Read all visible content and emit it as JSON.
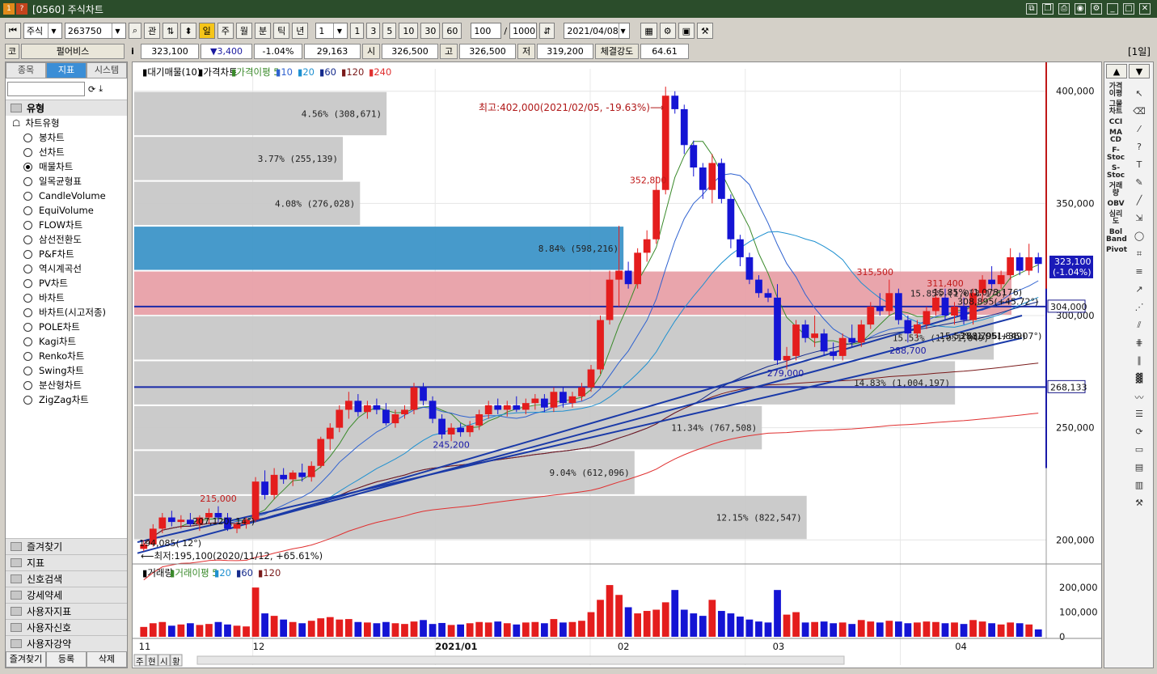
{
  "window": {
    "title": "[0560] 주식차트",
    "icons": [
      "1",
      "?"
    ]
  },
  "toolbar": {
    "market": "주식",
    "code": "263750",
    "btn_gwan": "관",
    "periods": [
      "일",
      "주",
      "월",
      "분",
      "틱",
      "년"
    ],
    "active_period": "일",
    "interval": "1",
    "quick_intervals": [
      "1",
      "3",
      "5",
      "10",
      "30",
      "60"
    ],
    "count": "100",
    "count_sep": "/",
    "max_count": "1000",
    "date": "2021/04/08"
  },
  "quote": {
    "code_label": "코",
    "name": "펄어비스",
    "info_label": "i",
    "price": "323,100",
    "change": "▼3,400",
    "change_pct": "-1.04%",
    "volume": "29,163",
    "open_label": "시",
    "open": "326,500",
    "high_label": "고",
    "high": "326,500",
    "low_label": "저",
    "low": "319,200",
    "strength_label": "체결강도",
    "strength": "64.61",
    "period_badge": "[1일]"
  },
  "left_panel": {
    "tabs": [
      "종목",
      "지표",
      "시스템"
    ],
    "active_tab": "지표",
    "section_type": "유형",
    "section_chart_type": "차트유형",
    "chart_types": [
      "봉차트",
      "선차트",
      "매물차트",
      "일목균형표",
      "CandleVolume",
      "EquiVolume",
      "FLOW차트",
      "삼선전환도",
      "P&F차트",
      "역시계곡선",
      "PV차트",
      "바차트",
      "바차트(시고저종)",
      "POLE차트",
      "Kagi차트",
      "Renko차트",
      "Swing차트",
      "분산형차트",
      "ZigZag차트"
    ],
    "selected_chart_type": "매물차트",
    "folders": [
      "즐겨찾기",
      "지표",
      "신호검색",
      "강세약세",
      "사용자지표",
      "사용자신호",
      "사용자강약"
    ],
    "bottom_tabs": [
      "즐겨찾기",
      "등록",
      "삭제"
    ]
  },
  "chart": {
    "legend_items": [
      {
        "text": "▮대기매물(10)",
        "color": "#000000"
      },
      {
        "text": "▮가격차트",
        "color": "#000000"
      },
      {
        "text": "▮가격이평 5",
        "color": "#3a8a2a"
      },
      {
        "text": "▮10",
        "color": "#2f62d0"
      },
      {
        "text": "▮20",
        "color": "#1e90d0"
      },
      {
        "text": "▮60",
        "color": "#142a8c"
      },
      {
        "text": "▮120",
        "color": "#7a1a1a"
      },
      {
        "text": "▮240",
        "color": "#e03030"
      }
    ],
    "annotations": {
      "high_note": "최고:402,000(2021/02/05, -19.63%)⟶",
      "low_note": "⟵최저:195,100(2020/11/12, +65.61%)",
      "peak_352": "352,800",
      "peak_215": "215,000",
      "low_245": "245,200",
      "low_279": "279,000",
      "peak_315": "315,500",
      "peak_311": "311,400",
      "low_288": "288,700",
      "trend_start": "194,085( 12°)",
      "trend_207": "207,120( 14°)",
      "overlap1": "15.85% (1,073,176)",
      "overlap2": "308,895(+45.72°)",
      "overlap3": "15.53%(1,051,849)",
      "overlap4": "288,796(+36.07°)"
    },
    "price_axis": [
      "400,000",
      "350,000",
      "300,000",
      "250,000",
      "200,000"
    ],
    "price_badge": "323,100",
    "price_badge_pct": "(-1.04%)",
    "line_badge_1": "304,000",
    "line_badge_2": "268,133",
    "volume_legend": [
      {
        "text": "▮거래량",
        "color": "#000000"
      },
      {
        "text": "▮거래이평 5",
        "color": "#3a8a2a"
      },
      {
        "text": "▮20",
        "color": "#1e90d0"
      },
      {
        "text": "▮60",
        "color": "#142a8c"
      },
      {
        "text": "▮120",
        "color": "#7a1a1a"
      }
    ],
    "volume_axis": [
      "200,000",
      "100,000",
      "0"
    ],
    "date_axis": [
      "11",
      "12",
      "2021/01",
      "02",
      "03",
      "04"
    ],
    "bottom_tabs": [
      "주",
      "현",
      "시",
      "황"
    ]
  },
  "colors": {
    "up": "#e41d1d",
    "down": "#1414d4",
    "profile_gray": "#c8c8c8",
    "profile_blue": "#3d95c8",
    "profile_pink": "#e8a0a8"
  },
  "chart_data": {
    "type": "bar",
    "title": "",
    "price_range": [
      190000,
      410000
    ],
    "profile_bins": [
      {
        "label": "4.56% (308,671)",
        "pct": 4.56,
        "volume": 308671,
        "lo": 380000,
        "hi": 400000
      },
      {
        "label": "3.77% (255,139)",
        "pct": 3.77,
        "volume": 255139,
        "lo": 360000,
        "hi": 380000
      },
      {
        "label": "4.08% (276,028)",
        "pct": 4.08,
        "volume": 276028,
        "lo": 340000,
        "hi": 360000
      },
      {
        "label": "8.84% (598,216)",
        "pct": 8.84,
        "volume": 598216,
        "lo": 320000,
        "hi": 340000,
        "highlight": "current"
      },
      {
        "label": "15.85% (1,073,176)",
        "pct": 15.85,
        "volume": 1073176,
        "lo": 300000,
        "hi": 320000,
        "highlight": "max"
      },
      {
        "label": "15.53% (1,051,849)",
        "pct": 15.53,
        "volume": 1051849,
        "lo": 280000,
        "hi": 300000
      },
      {
        "label": "14.83% (1,004,197)",
        "pct": 14.83,
        "volume": 1004197,
        "lo": 260000,
        "hi": 280000
      },
      {
        "label": "11.34% (767,508)",
        "pct": 11.34,
        "volume": 767508,
        "lo": 240000,
        "hi": 260000
      },
      {
        "label": "9.04% (612,096)",
        "pct": 9.04,
        "volume": 612096,
        "lo": 220000,
        "hi": 240000
      },
      {
        "label": "12.15% (822,547)",
        "pct": 12.15,
        "volume": 822547,
        "lo": 200000,
        "hi": 220000
      }
    ],
    "hlines": [
      304000,
      268133
    ],
    "candles": [
      [
        196,
        200,
        195,
        198
      ],
      [
        198,
        207,
        197,
        205
      ],
      [
        205,
        212,
        203,
        210
      ],
      [
        210,
        213,
        206,
        208
      ],
      [
        208,
        211,
        205,
        209
      ],
      [
        209,
        212,
        206,
        207
      ],
      [
        207,
        211,
        204,
        210
      ],
      [
        210,
        214,
        207,
        212
      ],
      [
        212,
        215,
        208,
        210
      ],
      [
        210,
        212,
        204,
        205
      ],
      [
        205,
        208,
        203,
        207
      ],
      [
        207,
        210,
        205,
        209
      ],
      [
        209,
        228,
        208,
        226
      ],
      [
        226,
        231,
        218,
        220
      ],
      [
        220,
        232,
        218,
        229
      ],
      [
        229,
        232,
        225,
        227
      ],
      [
        227,
        231,
        224,
        230
      ],
      [
        230,
        234,
        226,
        228
      ],
      [
        228,
        235,
        226,
        233
      ],
      [
        233,
        246,
        232,
        245
      ],
      [
        245,
        252,
        240,
        250
      ],
      [
        250,
        260,
        248,
        258
      ],
      [
        258,
        266,
        254,
        262
      ],
      [
        262,
        265,
        255,
        257
      ],
      [
        257,
        262,
        254,
        260
      ],
      [
        260,
        263,
        256,
        258
      ],
      [
        258,
        261,
        251,
        252
      ],
      [
        252,
        258,
        250,
        256
      ],
      [
        256,
        260,
        254,
        258
      ],
      [
        258,
        270,
        256,
        268
      ],
      [
        268,
        270,
        260,
        262
      ],
      [
        262,
        264,
        252,
        254
      ],
      [
        254,
        256,
        245,
        247
      ],
      [
        247,
        252,
        244,
        250
      ],
      [
        250,
        252,
        246,
        248
      ],
      [
        248,
        253,
        246,
        251
      ],
      [
        251,
        258,
        249,
        256
      ],
      [
        256,
        262,
        254,
        260
      ],
      [
        260,
        263,
        256,
        258
      ],
      [
        258,
        262,
        255,
        260
      ],
      [
        260,
        264,
        257,
        258
      ],
      [
        258,
        263,
        256,
        261
      ],
      [
        261,
        265,
        258,
        263
      ],
      [
        263,
        265,
        257,
        259
      ],
      [
        259,
        268,
        257,
        266
      ],
      [
        266,
        268,
        259,
        261
      ],
      [
        261,
        266,
        259,
        264
      ],
      [
        264,
        270,
        262,
        268
      ],
      [
        268,
        278,
        266,
        276
      ],
      [
        276,
        300,
        274,
        298
      ],
      [
        298,
        320,
        296,
        316
      ],
      [
        316,
        340,
        304,
        320
      ],
      [
        320,
        324,
        312,
        314
      ],
      [
        314,
        330,
        312,
        328
      ],
      [
        328,
        338,
        324,
        334
      ],
      [
        334,
        362,
        332,
        356
      ],
      [
        356,
        402,
        354,
        398
      ],
      [
        398,
        400,
        390,
        392
      ],
      [
        392,
        394,
        372,
        376
      ],
      [
        376,
        378,
        362,
        366
      ],
      [
        366,
        368,
        352,
        356
      ],
      [
        356,
        372,
        350,
        368
      ],
      [
        368,
        370,
        350,
        352
      ],
      [
        352,
        354,
        330,
        334
      ],
      [
        334,
        336,
        322,
        326
      ],
      [
        326,
        328,
        314,
        316
      ],
      [
        316,
        318,
        308,
        310
      ],
      [
        310,
        312,
        306,
        308
      ],
      [
        308,
        314,
        278,
        280
      ],
      [
        280,
        286,
        276,
        282
      ],
      [
        282,
        298,
        280,
        296
      ],
      [
        296,
        298,
        288,
        290
      ],
      [
        290,
        300,
        286,
        292
      ],
      [
        292,
        294,
        282,
        284
      ],
      [
        284,
        288,
        280,
        282
      ],
      [
        282,
        292,
        280,
        290
      ],
      [
        290,
        296,
        286,
        288
      ],
      [
        288,
        298,
        286,
        296
      ],
      [
        296,
        306,
        294,
        304
      ],
      [
        304,
        310,
        300,
        302
      ],
      [
        302,
        316,
        300,
        310
      ],
      [
        310,
        312,
        296,
        298
      ],
      [
        298,
        300,
        288,
        292
      ],
      [
        292,
        298,
        290,
        296
      ],
      [
        296,
        304,
        294,
        302
      ],
      [
        302,
        312,
        300,
        308
      ],
      [
        308,
        312,
        298,
        300
      ],
      [
        300,
        306,
        296,
        304
      ],
      [
        304,
        308,
        296,
        298
      ],
      [
        298,
        312,
        296,
        310
      ],
      [
        310,
        318,
        306,
        316
      ],
      [
        316,
        322,
        312,
        314
      ],
      [
        314,
        320,
        312,
        318
      ],
      [
        318,
        330,
        316,
        326
      ],
      [
        326,
        328,
        318,
        320
      ],
      [
        320,
        332,
        318,
        326
      ],
      [
        326,
        328,
        319,
        323
      ]
    ],
    "volumes": [
      40,
      55,
      60,
      45,
      50,
      55,
      48,
      52,
      60,
      50,
      45,
      42,
      200,
      95,
      85,
      70,
      60,
      55,
      65,
      75,
      80,
      70,
      72,
      60,
      58,
      55,
      60,
      55,
      52,
      62,
      68,
      52,
      56,
      48,
      50,
      55,
      60,
      58,
      62,
      55,
      50,
      58,
      60,
      55,
      72,
      58,
      60,
      65,
      100,
      150,
      210,
      170,
      120,
      95,
      105,
      110,
      140,
      190,
      110,
      95,
      85,
      150,
      105,
      95,
      82,
      70,
      62,
      58,
      190,
      90,
      100,
      58,
      60,
      62,
      55,
      58,
      52,
      68,
      62,
      58,
      65,
      62,
      55,
      58,
      62,
      60,
      55,
      58,
      52,
      68,
      62,
      55,
      50,
      58,
      55,
      50,
      30
    ],
    "volume_range": [
      0,
      230000
    ]
  }
}
